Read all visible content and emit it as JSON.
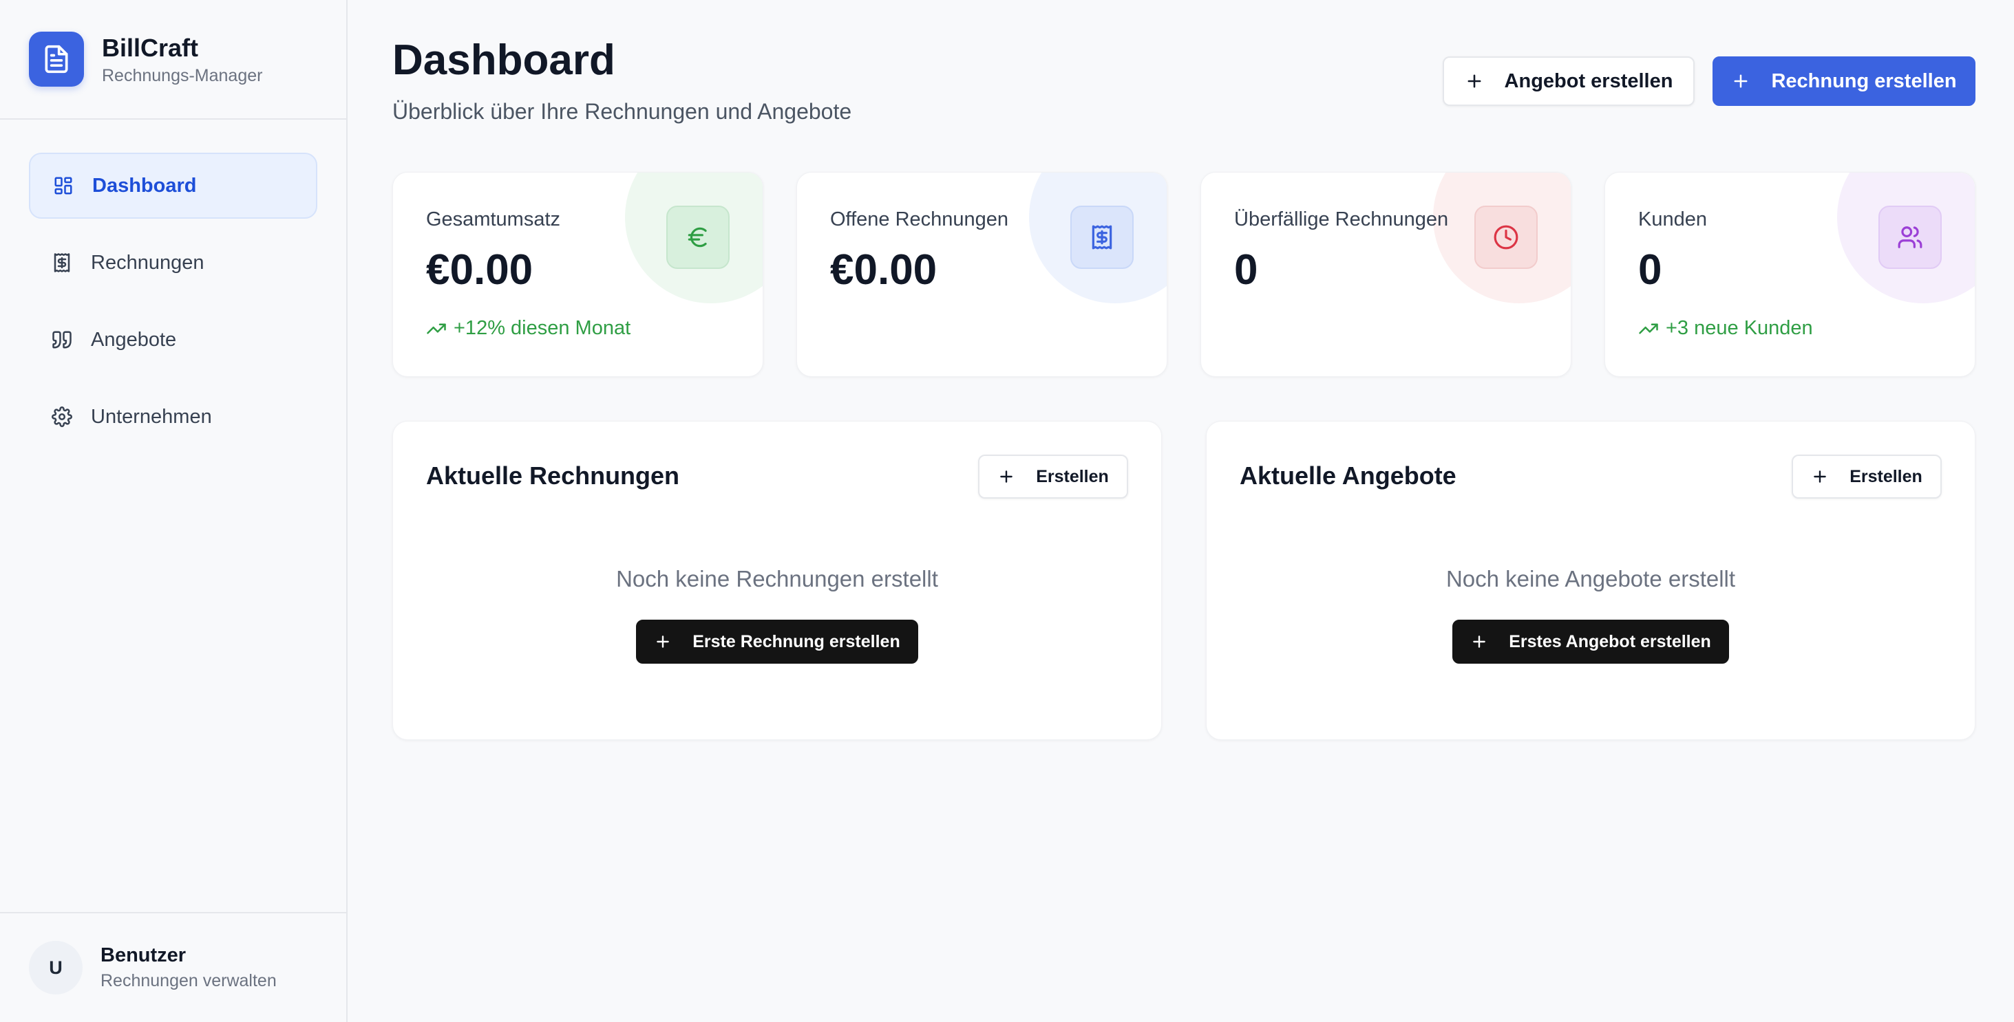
{
  "brand": {
    "name": "BillCraft",
    "subtitle": "Rechnungs-Manager",
    "logo_icon": "file-text-icon"
  },
  "sidebar": {
    "items": [
      {
        "label": "Dashboard",
        "icon": "layout-dashboard-icon",
        "active": true
      },
      {
        "label": "Rechnungen",
        "icon": "receipt-icon",
        "active": false
      },
      {
        "label": "Angebote",
        "icon": "quote-icon",
        "active": false
      },
      {
        "label": "Unternehmen",
        "icon": "settings-icon",
        "active": false
      }
    ]
  },
  "user": {
    "initial": "U",
    "name": "Benutzer",
    "subtitle": "Rechnungen verwalten"
  },
  "header": {
    "title": "Dashboard",
    "subtitle": "Überblick über Ihre Rechnungen und Angebote",
    "actions": {
      "offer_label": "Angebot erstellen",
      "invoice_label": "Rechnung erstellen"
    }
  },
  "stats": [
    {
      "label": "Gesamtumsatz",
      "value": "€0.00",
      "trend": "+12% diesen Monat",
      "icon": "euro-icon",
      "accent": "#2f9e44"
    },
    {
      "label": "Offene Rechnungen",
      "value": "€0.00",
      "trend": "",
      "icon": "receipt-icon",
      "accent": "#3b63e0"
    },
    {
      "label": "Überfällige Rechnungen",
      "value": "0",
      "trend": "",
      "icon": "clock-icon",
      "accent": "#dc3545"
    },
    {
      "label": "Kunden",
      "value": "0",
      "trend": "+3 neue Kunden",
      "icon": "users-icon",
      "accent": "#9b3fd6"
    }
  ],
  "panels": {
    "invoices": {
      "title": "Aktuelle Rechnungen",
      "create_label": "Erstellen",
      "empty_text": "Noch keine Rechnungen erstellt",
      "cta_label": "Erste Rechnung erstellen"
    },
    "offers": {
      "title": "Aktuelle Angebote",
      "create_label": "Erstellen",
      "empty_text": "Noch keine Angebote erstellt",
      "cta_label": "Erstes Angebot erstellen"
    }
  },
  "colors": {
    "primary": "#3b63e0",
    "success": "#2f9e44",
    "danger": "#dc3545",
    "purple": "#9b3fd6",
    "background": "#f8f9fb"
  }
}
